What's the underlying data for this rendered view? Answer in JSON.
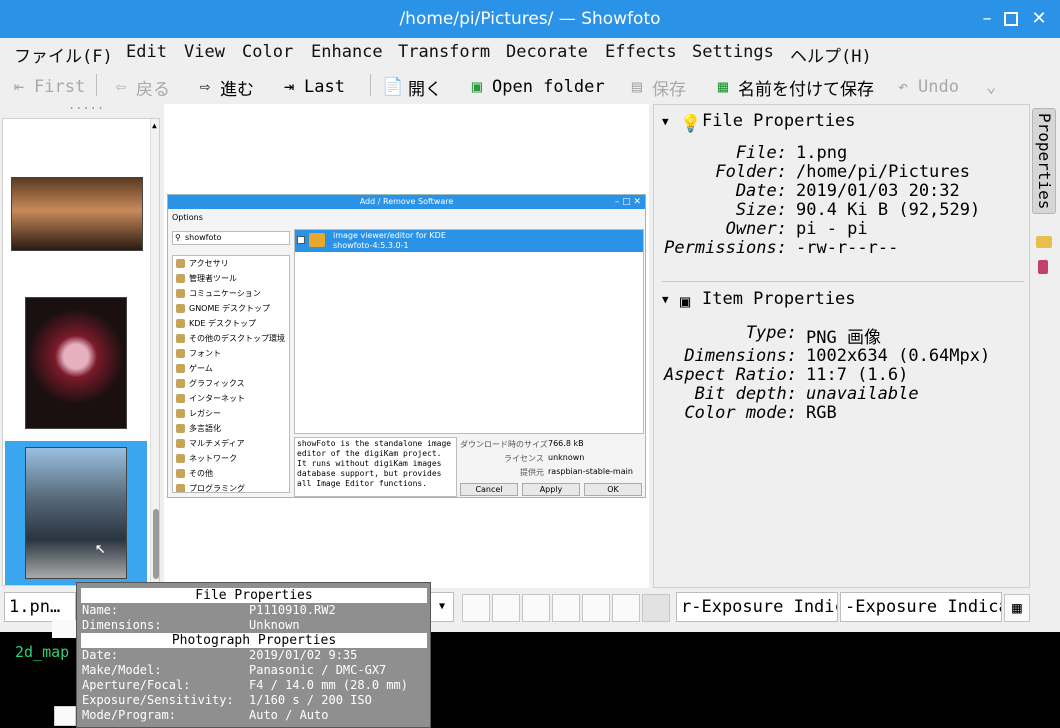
{
  "window": {
    "title": "/home/pi/Pictures/ — Showfoto"
  },
  "menu": [
    "ファイル(F)",
    "Edit",
    "View",
    "Color",
    "Enhance",
    "Transform",
    "Decorate",
    "Effects",
    "Settings",
    "ヘルプ(H)"
  ],
  "toolbar": {
    "first": "First",
    "back": "戻る",
    "forward": "進む",
    "last": "Last",
    "open": "開く",
    "open_folder": "Open folder",
    "save": "保存",
    "save_as": "名前を付けて保存",
    "undo": "Undo"
  },
  "thumbbar": {
    "handle": "....."
  },
  "dialog": {
    "title": "Add / Remove Software",
    "options": "Options",
    "search": "showfoto",
    "categories": [
      "アクセサリ",
      "管理者ツール",
      "コミュニケーション",
      "GNOME デスクトップ",
      "KDE デスクトップ",
      "その他のデスクトップ環境",
      "フォント",
      "ゲーム",
      "グラフィックス",
      "インターネット",
      "レガシー",
      "多言語化",
      "マルチメディア",
      "ネットワーク",
      "その他",
      "プログラミング"
    ],
    "package_title": "image viewer/editor for KDE",
    "package_name": "showfoto-4:5.3.0-1",
    "description": "showFoto is the standalone image editor of the digiKam project. It runs without digiKam images database support, but provides all Image Editor functions.",
    "download_size_label": "ダウンロード時のサイズ",
    "download_size": "766.8 kB",
    "license_label": "ライセンス",
    "license": "unknown",
    "source_label": "提供元",
    "source": "raspbian-stable-main",
    "cancel": "Cancel",
    "apply": "Apply",
    "ok": "OK"
  },
  "file_properties": {
    "header": "File Properties",
    "rows": [
      {
        "k": "File:",
        "v": "1.png"
      },
      {
        "k": "Folder:",
        "v": "/home/pi/Pictures"
      },
      {
        "k": "Date:",
        "v": "2019/01/03 20:32"
      },
      {
        "k": "Size:",
        "v": "90.4 Ki B (92,529)"
      },
      {
        "k": "Owner:",
        "v": "pi - pi"
      },
      {
        "k": "Permissions:",
        "v": "-rw-r--r--"
      }
    ]
  },
  "item_properties": {
    "header": "Item Properties",
    "rows": [
      {
        "k": "Type:",
        "v": "PNG 画像"
      },
      {
        "k": "Dimensions:",
        "v": "1002x634 (0.64Mpx)"
      },
      {
        "k": "Aspect Ratio:",
        "v": "11:7 (1.6)"
      },
      {
        "k": "Bit depth:",
        "v": "unavailable"
      },
      {
        "k": "Color mode:",
        "v": "RGB"
      }
    ]
  },
  "sidetab": "Properties",
  "status": {
    "file": "1.pn…",
    "exposure1": "r-Exposure Indic",
    "exposure2": "-Exposure Indica"
  },
  "desktop": {
    "label": "2d_map"
  },
  "tooltip": {
    "file_header": "File Properties",
    "name_k": "Name:",
    "name_v": "P1110910.RW2",
    "dims_k": "Dimensions:",
    "dims_v": "Unknown",
    "photo_header": "Photograph Properties",
    "date_k": "Date:",
    "date_v": "2019/01/02 9:35",
    "make_k": "Make/Model:",
    "make_v": "Panasonic / DMC-GX7",
    "ap_k": "Aperture/Focal:",
    "ap_v": "F4 / 14.0 mm (28.0 mm)",
    "exp_k": "Exposure/Sensitivity:",
    "exp_v": "1/160 s / 200 ISO",
    "mode_k": "Mode/Program:",
    "mode_v": "Auto / Auto"
  }
}
